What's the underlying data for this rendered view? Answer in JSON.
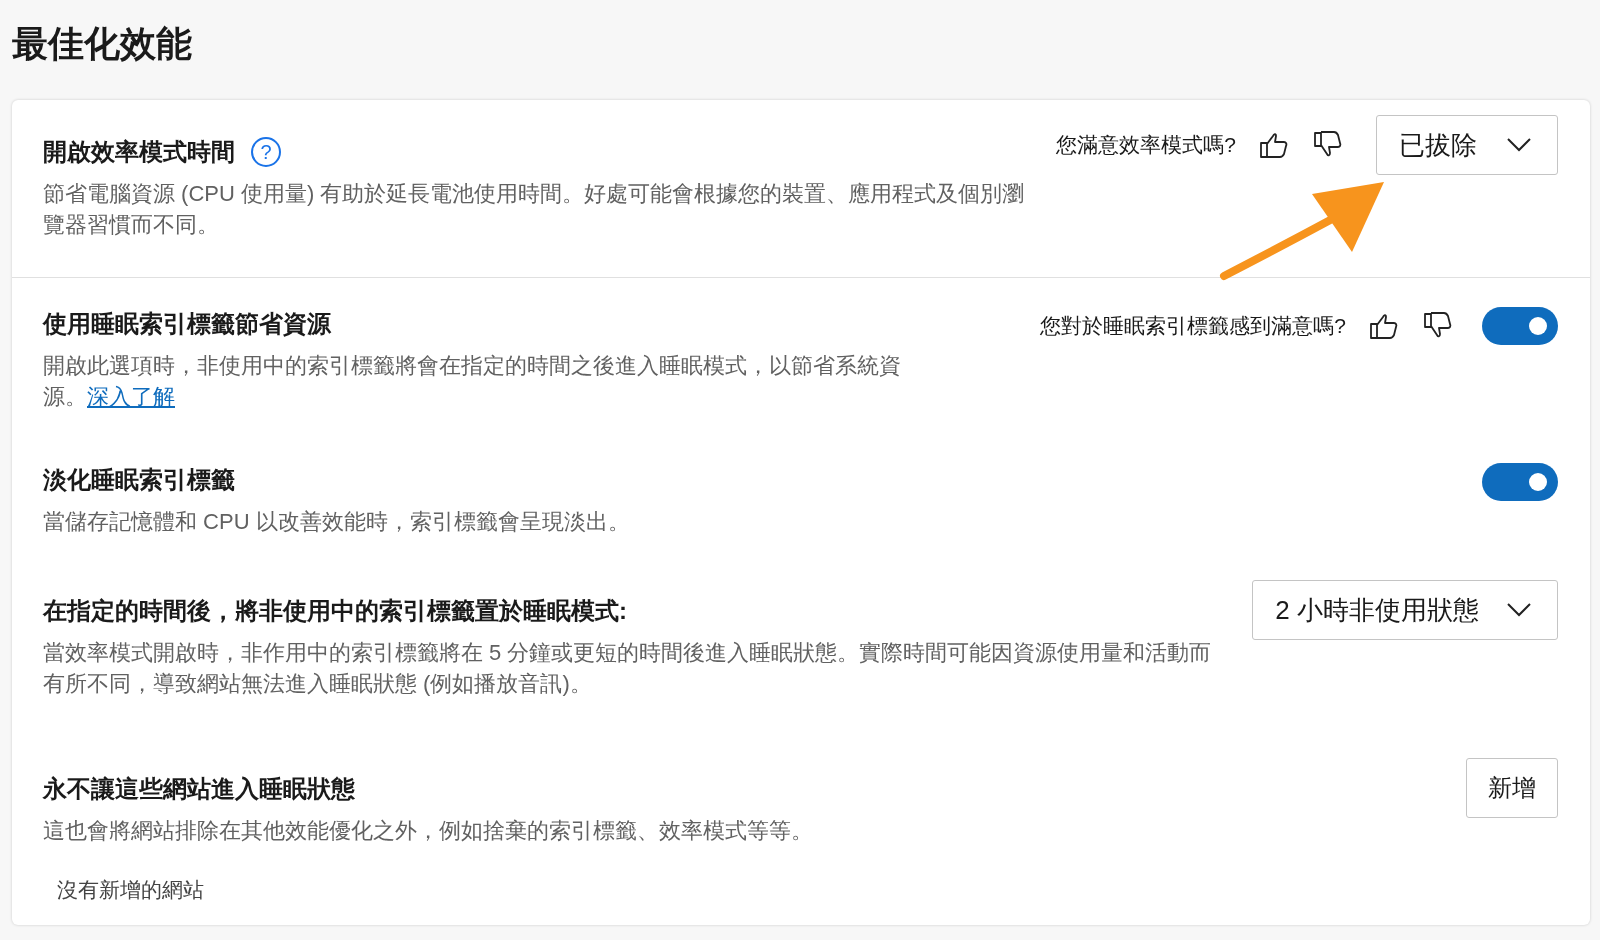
{
  "page": {
    "title": "最佳化效能"
  },
  "sections": [
    {
      "kind": "dropdown",
      "title": "開啟效率模式時間",
      "help": "?",
      "feedback": {
        "question": "您滿意效率模式嗎?"
      },
      "value": "已拔除",
      "description": "節省電腦資源 (CPU 使用量) 有助於延長電池使用時間。好處可能會根據您的裝置、應用程式及個別瀏覽器習慣而不同。",
      "divider": true
    },
    {
      "kind": "toggle",
      "title": "使用睡眠索引標籤節省資源",
      "feedback": {
        "question": "您對於睡眠索引標籤感到滿意嗎?"
      },
      "on": true,
      "description": "開啟此選項時，非使用中的索引標籤將會在指定的時間之後進入睡眠模式，以節省系統資源。",
      "link": "深入了解"
    },
    {
      "kind": "toggle",
      "title": "淡化睡眠索引標籤",
      "on": true,
      "description": "當儲存記憶體和 CPU 以改善效能時，索引標籤會呈現淡出。"
    },
    {
      "kind": "dropdown",
      "title": "在指定的時間後，將非使用中的索引標籤置於睡眠模式:",
      "value": "2 小時非使用狀態",
      "description": "當效率模式開啟時，非作用中的索引標籤將在 5 分鐘或更短的時間後進入睡眠狀態。實際時間可能因資源使用量和活動而有所不同，導致網站無法進入睡眠狀態 (例如播放音訊)。"
    },
    {
      "kind": "list",
      "title": "永不讓這些網站進入睡眠狀態",
      "button": "新增",
      "description": "這也會將網站排除在其他效能優化之外，例如捨棄的索引標籤、效率模式等等。",
      "empty": "沒有新增的網站"
    }
  ]
}
